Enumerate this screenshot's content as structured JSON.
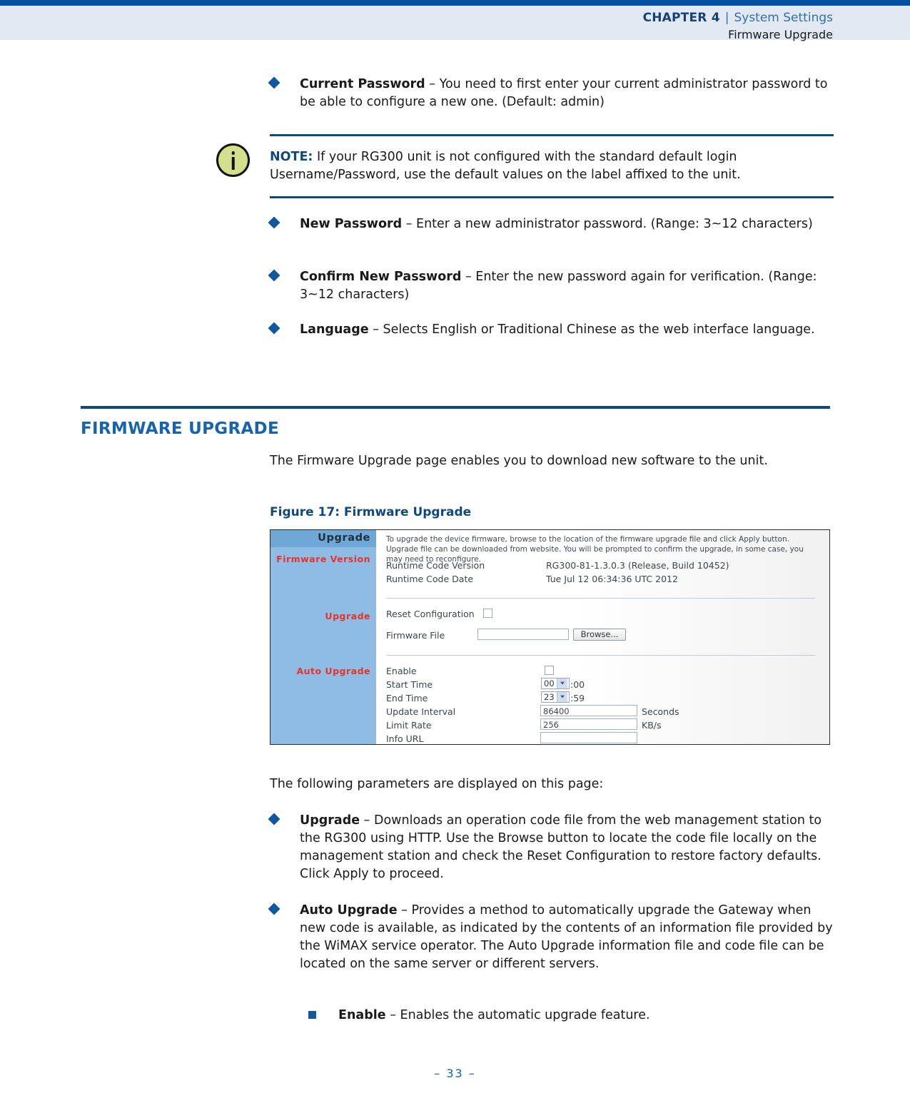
{
  "header": {
    "chapter": "CHAPTER 4",
    "divider": "|",
    "section": "System Settings",
    "subtitle": "Firmware Upgrade"
  },
  "bullets_top": [
    {
      "term": "Current Password",
      "dash": " – ",
      "text": "You need to first enter your current administrator password to be able to configure a new one. (Default: admin)"
    }
  ],
  "note": {
    "icon": "info-icon",
    "label": "NOTE:",
    "text": " If your RG300 unit is not configured with the standard default login Username/Password, use the default values on the label affixed to the unit."
  },
  "bullets_mid": [
    {
      "term": "New Password",
      "dash": " – ",
      "text": "Enter a new administrator password. (Range: 3~12 characters)"
    },
    {
      "term": "Confirm New Password",
      "dash": " – ",
      "text": "Enter the new password again for verification. (Range: 3~12 characters)"
    },
    {
      "term": "Language",
      "dash": " – ",
      "text": "Selects English or Traditional Chinese as the web interface language."
    }
  ],
  "section": {
    "title_first": "F",
    "title_rest": "IRMWARE ",
    "title_second": "U",
    "title_rest2": "PGRADE",
    "title_plain": "FIRMWARE UPGRADE",
    "intro": "The Firmware Upgrade page enables you to download new software to the unit.",
    "figure_caption": "Figure 17:  Firmware Upgrade"
  },
  "screenshot": {
    "panel_title": "Upgrade",
    "side_labels": [
      "Firmware Version",
      "Upgrade",
      "Auto Upgrade"
    ],
    "intro_text": "To upgrade the device firmware, browse to the location of the firmware upgrade file and click Apply button. Upgrade file can be downloaded from website. You will be prompted to confirm the upgrade, in some case, you may need to reconfigure.",
    "firmware_version": {
      "runtime_code_version_label": "Runtime Code Version",
      "runtime_code_version_value": "RG300-81-1.3.0.3 (Release, Build 10452)",
      "runtime_code_date_label": "Runtime Code Date",
      "runtime_code_date_value": "Tue Jul 12 06:34:36 UTC 2012"
    },
    "upgrade": {
      "reset_configuration_label": "Reset Configuration",
      "reset_configuration_checked": false,
      "firmware_file_label": "Firmware File",
      "firmware_file_value": "",
      "browse_button": "Browse..."
    },
    "auto_upgrade": {
      "enable_label": "Enable",
      "enable_checked": false,
      "start_time_label": "Start Time",
      "start_time_hour": "00",
      "start_time_minute": ":00",
      "end_time_label": "End Time",
      "end_time_hour": "23",
      "end_time_minute": ":59",
      "update_interval_label": "Update Interval",
      "update_interval_value": "86400",
      "update_interval_unit": "Seconds",
      "limit_rate_label": "Limit Rate",
      "limit_rate_value": "256",
      "limit_rate_unit": "KB/s",
      "info_url_label": "Info URL",
      "info_url_value": ""
    }
  },
  "params_intro": "The following parameters are displayed on this page:",
  "bullets_bottom": [
    {
      "term": "Upgrade",
      "dash": " – ",
      "text": "Downloads an operation code file from the web management station to the RG300 using HTTP. Use the Browse button to locate the code file locally on the management station and check the Reset Configuration to restore factory defaults. Click Apply to proceed."
    },
    {
      "term": "Auto Upgrade",
      "dash": " – ",
      "text": "Provides a method to automatically upgrade the Gateway when new code is available, as indicated by the contents of an information file provided by the WiMAX service operator. The Auto Upgrade information file and code file can be located on the same server or different servers."
    }
  ],
  "subbullets": [
    {
      "term": "Enable",
      "dash": " – ",
      "text": "Enables the automatic upgrade feature."
    }
  ],
  "footer": {
    "page_number": "–  33  –"
  },
  "colors": {
    "header_rule": "#00509e",
    "header_band": "#e3e9f3",
    "accent_blue": "#10487f",
    "title_blue": "#1763ad",
    "bullet_blue": "#10579e",
    "panel_side": "#8ebce4",
    "panel_side_header": "#6fa8d6",
    "panel_label_red": "#e8332a"
  }
}
